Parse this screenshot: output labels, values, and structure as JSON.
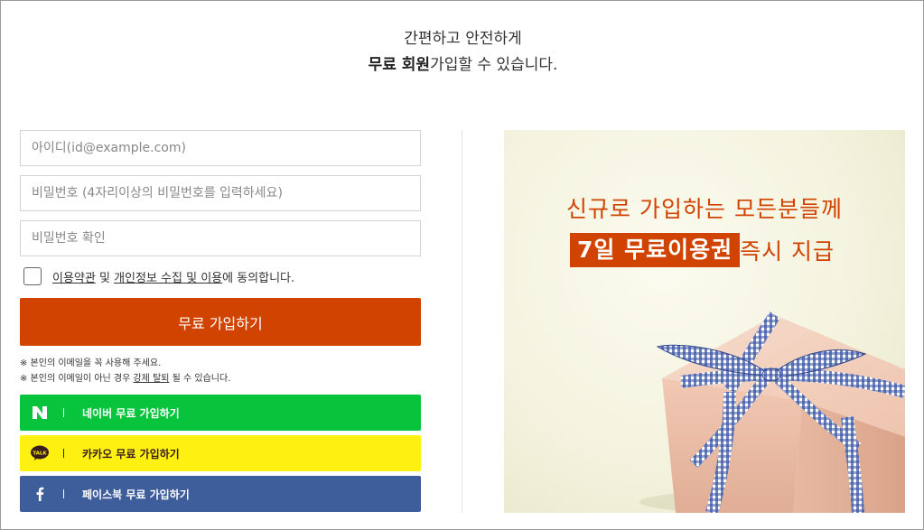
{
  "heading": {
    "line1": "간편하고 안전하게",
    "line2_bold": "무료 회원",
    "line2_rest": "가입할 수 있습니다."
  },
  "form": {
    "id_placeholder": "아이디(id@example.com)",
    "password_placeholder": "비밀번호 (4자리이상의 비밀번호를 입력하세요)",
    "password_confirm_placeholder": "비밀번호 확인",
    "agree": {
      "terms_link": "이용약관",
      "and": " 및 ",
      "privacy_link": "개인정보 수집 및 이용",
      "suffix": "에 동의합니다."
    },
    "join_button": "무료 가입하기",
    "notes": {
      "note1": "※ 본인의 이메일을 꼭 사용해 주세요.",
      "note2_prefix": "※ 본인의 이메일이 아닌 경우 ",
      "note2_link": "강제 탈퇴",
      "note2_suffix": " 될 수 있습니다."
    }
  },
  "social": {
    "naver_label": "네이버 무료 가입하기",
    "kakao_label": "카카오 무료 가입하기",
    "facebook_label": "페이스북 무료 가입하기",
    "naver_icon": "N",
    "kakao_icon": "TALK",
    "facebook_icon": "f"
  },
  "promo": {
    "line1": "신규로 가입하는 모든분들께",
    "highlight": "7일 무료이용권",
    "line2_rest": "즉시 지급"
  },
  "colors": {
    "accent": "#d04300",
    "naver": "#08c43c",
    "kakao": "#fef011",
    "facebook": "#3e5d9b"
  }
}
